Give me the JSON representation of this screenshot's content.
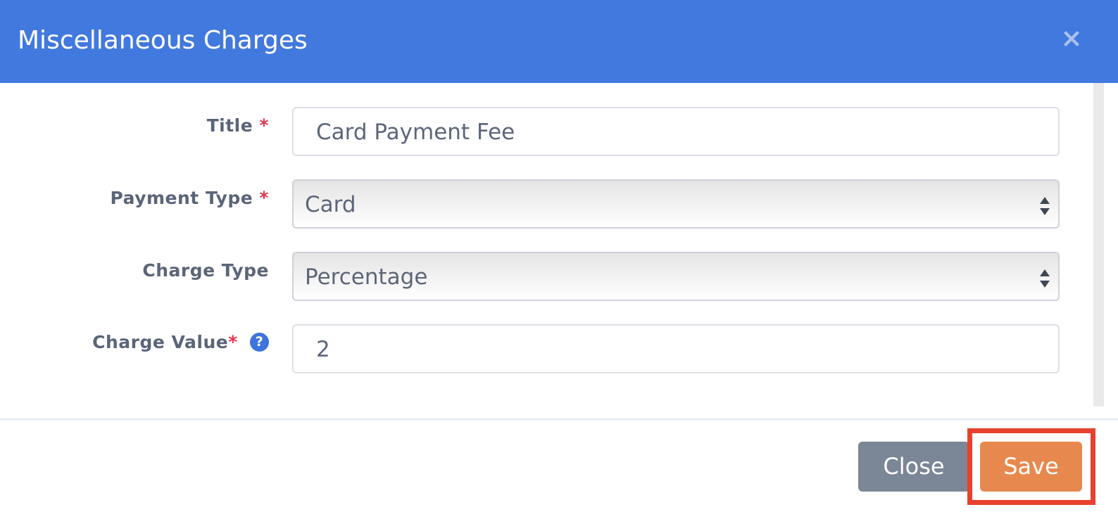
{
  "modal": {
    "title": "Miscellaneous Charges",
    "close_icon": "close-x-icon"
  },
  "form": {
    "title": {
      "label": "Title",
      "required_mark": "*",
      "value": "Card Payment Fee"
    },
    "payment_type": {
      "label": "Payment Type",
      "required_mark": "*",
      "selected": "Card"
    },
    "charge_type": {
      "label": "Charge Type",
      "selected": "Percentage"
    },
    "charge_value": {
      "label": "Charge Value",
      "required_mark": "*",
      "help_icon": "question-circle-icon",
      "help_glyph": "?",
      "value": "2"
    }
  },
  "footer": {
    "close_label": "Close",
    "save_label": "Save"
  },
  "colors": {
    "header": "#4279de",
    "save_button": "#e7894e",
    "close_button": "#7b8697",
    "highlight": "#e8412e",
    "required": "#e0344b"
  }
}
